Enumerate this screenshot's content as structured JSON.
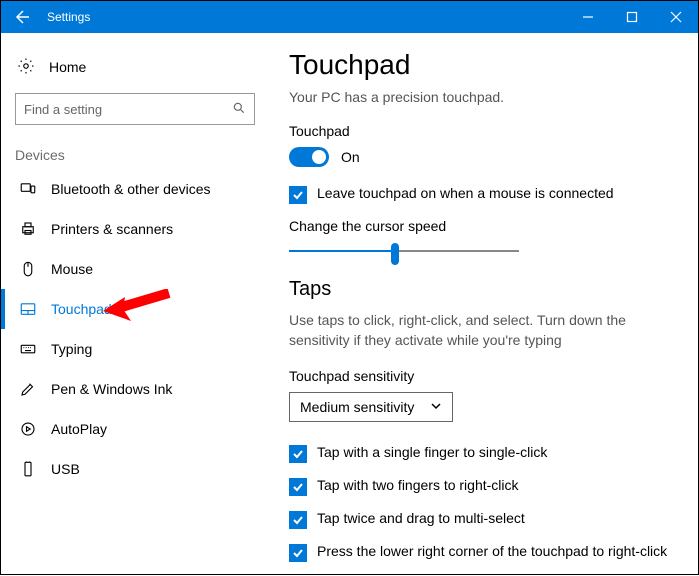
{
  "window": {
    "title": "Settings"
  },
  "sidebar": {
    "home": "Home",
    "search_placeholder": "Find a setting",
    "category": "Devices",
    "items": [
      {
        "label": "Bluetooth & other devices"
      },
      {
        "label": "Printers & scanners"
      },
      {
        "label": "Mouse"
      },
      {
        "label": "Touchpad"
      },
      {
        "label": "Typing"
      },
      {
        "label": "Pen & Windows Ink"
      },
      {
        "label": "AutoPlay"
      },
      {
        "label": "USB"
      }
    ]
  },
  "main": {
    "heading": "Touchpad",
    "subtitle": "Your PC has a precision touchpad.",
    "toggle_label": "Touchpad",
    "toggle_state": "On",
    "leave_on_label": "Leave touchpad on when a mouse is connected",
    "speed_label": "Change the cursor speed",
    "cursor_speed_percent": 46,
    "taps_heading": "Taps",
    "taps_desc": "Use taps to click, right-click, and select. Turn down the sensitivity if they activate while you're typing",
    "sensitivity_label": "Touchpad sensitivity",
    "sensitivity_value": "Medium sensitivity",
    "tap_options": [
      "Tap with a single finger to single-click",
      "Tap with two fingers to right-click",
      "Tap twice and drag to multi-select",
      "Press the lower right corner of the touchpad to right-click"
    ]
  }
}
